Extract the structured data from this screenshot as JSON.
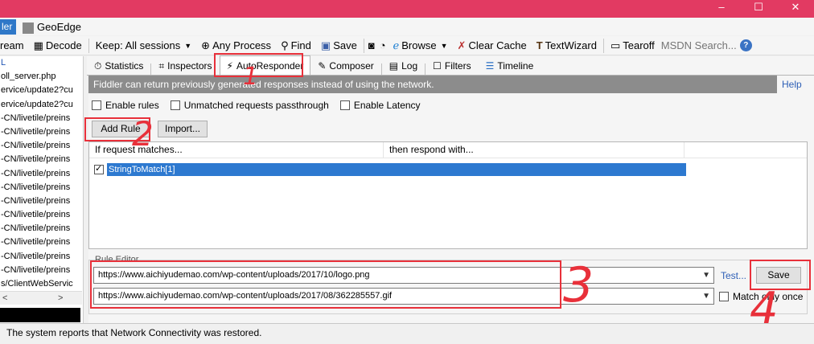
{
  "window": {
    "left_tab": "ler",
    "geoedge_tab": "GeoEdge",
    "controls": [
      "–",
      "☐",
      "✕"
    ]
  },
  "toolbar": {
    "stream": "ream",
    "decode": "Decode",
    "keep": "Keep: All sessions",
    "any_process": "Any Process",
    "find": "Find",
    "save": "Save",
    "browse": "Browse",
    "clear_cache": "Clear Cache",
    "textwizard": "TextWizard",
    "tearoff": "Tearoff",
    "msdn_placeholder": "MSDN Search...",
    "help": "?"
  },
  "sessions": [
    "L",
    "oll_server.php",
    "ervice/update2?cu",
    "ervice/update2?cu",
    "-CN/livetile/preins",
    "-CN/livetile/preins",
    "-CN/livetile/preins",
    "-CN/livetile/preins",
    "-CN/livetile/preins",
    "-CN/livetile/preins",
    "-CN/livetile/preins",
    "-CN/livetile/preins",
    "-CN/livetile/preins",
    "-CN/livetile/preins",
    "-CN/livetile/preins",
    "-CN/livetile/preins",
    "s/ClientWebServic"
  ],
  "session_scroll": {
    "left": "<",
    "right": ">"
  },
  "tabs": [
    {
      "label": "Statistics",
      "icon": "stopwatch-icon",
      "glyph": "⏱"
    },
    {
      "label": "Inspectors",
      "icon": "inspect-icon",
      "glyph": "⌗"
    },
    {
      "label": "AutoResponder",
      "icon": "lightning-icon",
      "glyph": "⚡"
    },
    {
      "label": "Composer",
      "icon": "pencil-icon",
      "glyph": "✎"
    },
    {
      "label": "Log",
      "icon": "log-icon",
      "glyph": "▤"
    },
    {
      "label": "Filters",
      "icon": "filter-icon",
      "glyph": "☐"
    },
    {
      "label": "Timeline",
      "icon": "timeline-icon",
      "glyph": "☰"
    }
  ],
  "autoresponder": {
    "info": "Fiddler can return previously generated responses instead of using the network.",
    "help": "Help",
    "enable_rules": "Enable rules",
    "unmatched": "Unmatched requests passthrough",
    "enable_latency": "Enable Latency",
    "add_rule": "Add Rule",
    "import": "Import...",
    "col_match": "If request matches...",
    "col_respond": "then respond with...",
    "rule": "StringToMatch[1]",
    "editor_label": "Rule Editor",
    "match_value": "https://www.aichiyudemao.com/wp-content/uploads/2017/10/logo.png",
    "respond_value": "https://www.aichiyudemao.com/wp-content/uploads/2017/08/362285557.gif",
    "test": "Test...",
    "save": "Save",
    "match_once": "Match only once"
  },
  "annotations": [
    "1",
    "2",
    "3",
    "4"
  ],
  "status": "The system reports that Network Connectivity was restored."
}
